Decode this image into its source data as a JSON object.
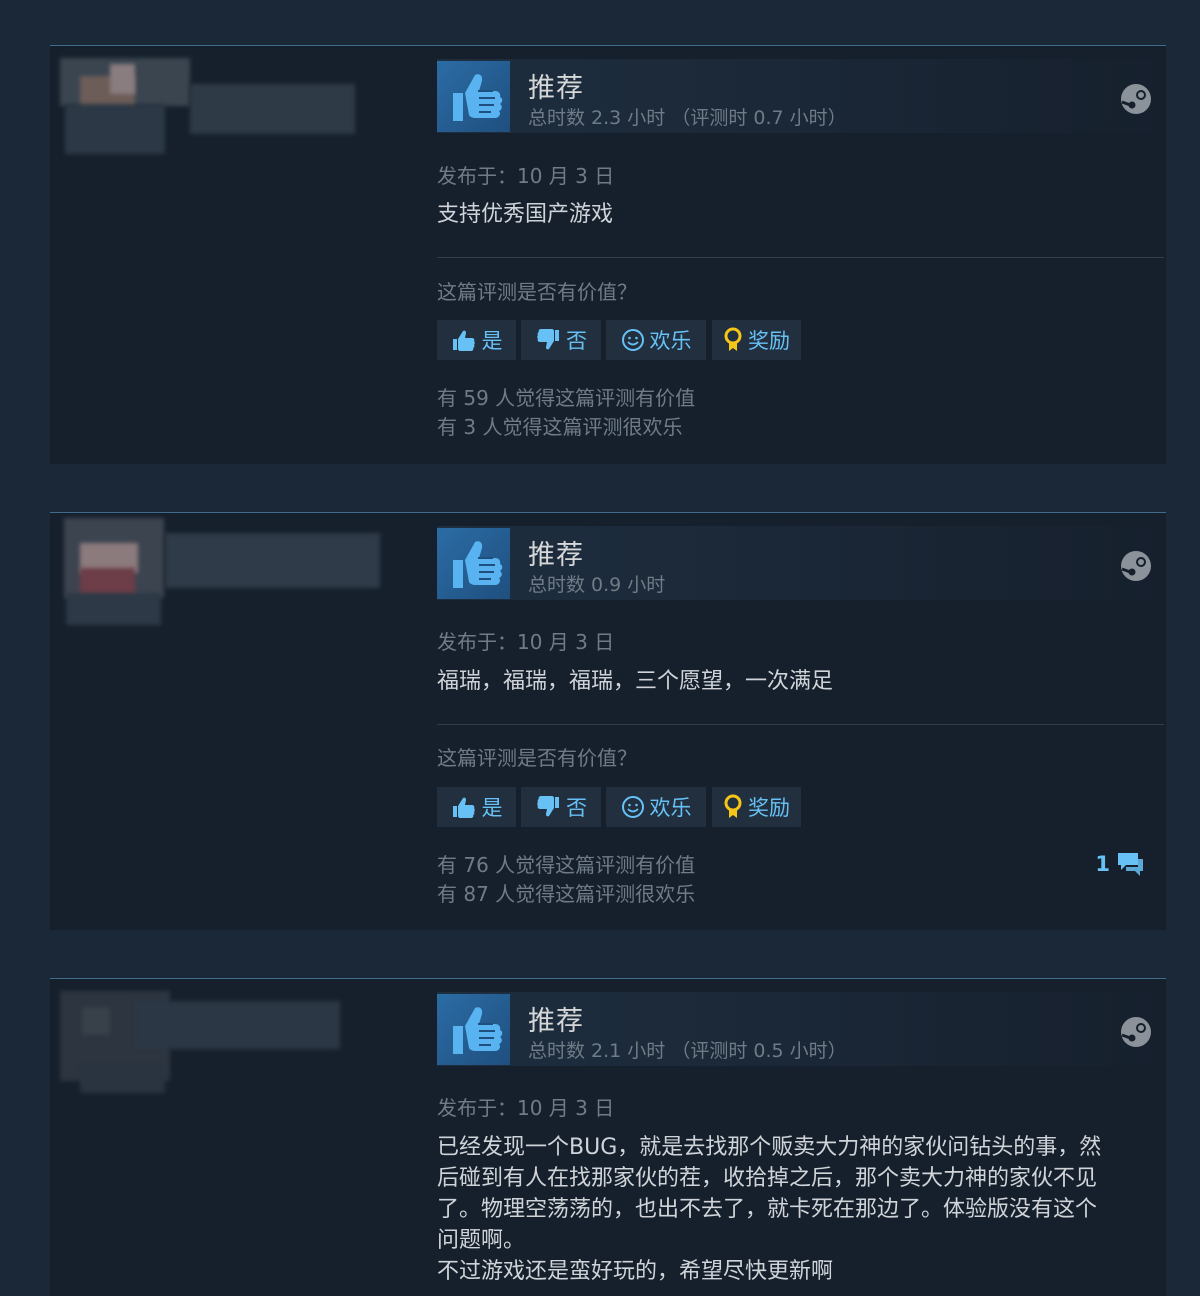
{
  "reviews": [
    {
      "title": "推荐",
      "hours": "总时数 2.3 小时 （评测时 0.7 小时）",
      "posted": "发布于：10 月 3 日",
      "content": "支持优秀国产游戏",
      "helpful_question": "这篇评测是否有价值？",
      "buttons": {
        "yes": "是",
        "no": "否",
        "funny": "欢乐",
        "award": "奖励"
      },
      "helpful_count": "有 59 人觉得这篇评测有价值",
      "funny_count": "有 3 人觉得这篇评测很欢乐"
    },
    {
      "title": "推荐",
      "hours": "总时数 0.9 小时",
      "posted": "发布于：10 月 3 日",
      "content": "福瑞，福瑞，福瑞，三个愿望，一次满足",
      "helpful_question": "这篇评测是否有价值？",
      "buttons": {
        "yes": "是",
        "no": "否",
        "funny": "欢乐",
        "award": "奖励"
      },
      "helpful_count": "有 76 人觉得这篇评测有价值",
      "funny_count": "有 87 人觉得这篇评测很欢乐",
      "comment_count": "1"
    },
    {
      "title": "推荐",
      "hours": "总时数 2.1 小时 （评测时 0.5 小时）",
      "posted": "发布于：10 月 3 日",
      "content_lines": [
        "已经发现一个BUG，就是去找那个贩卖大力神的家伙问钻头的事，然",
        "后碰到有人在找那家伙的茬，收拾掉之后，那个卖大力神的家伙不见",
        "了。物理空荡荡的，也出不去了，就卡死在那边了。体验版没有这个",
        "问题啊。",
        "不过游戏还是蛮好玩的，希望尽快更新啊"
      ]
    }
  ],
  "colors": {
    "page_bg": "#1b2838",
    "card_bg": "#16202d",
    "accent_blue": "#67c1f5",
    "muted_text": "#6f7b86"
  },
  "icons": [
    "thumbs-up-icon",
    "thumbs-down-icon",
    "smiley-icon",
    "award-icon",
    "steam-icon",
    "comment-icon"
  ]
}
